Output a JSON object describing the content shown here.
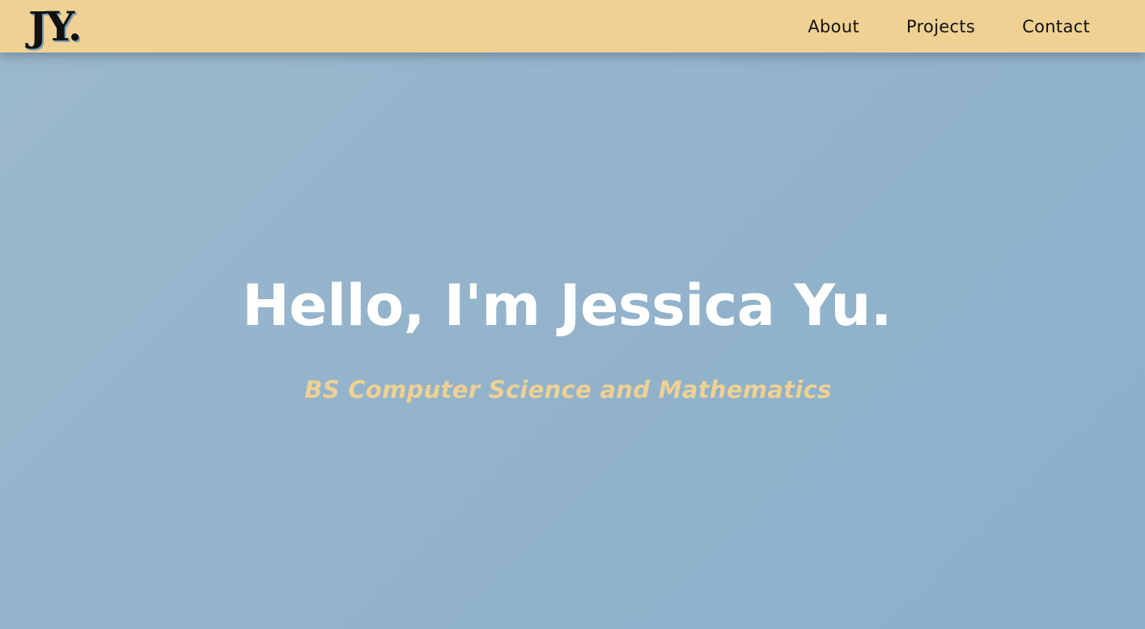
{
  "header": {
    "logo_text": "JY.",
    "nav": [
      {
        "label": "About"
      },
      {
        "label": "Projects"
      },
      {
        "label": "Contact"
      }
    ]
  },
  "hero": {
    "title": "Hello, I'm Jessica Yu.",
    "subtitle": "BS Computer Science and Mathematics"
  },
  "colors": {
    "navbar_bg": "#efd193",
    "hero_bg": "#93b3cb",
    "title_text": "#ffffff",
    "subtitle_text": "#efd193",
    "nav_text": "#111111"
  }
}
